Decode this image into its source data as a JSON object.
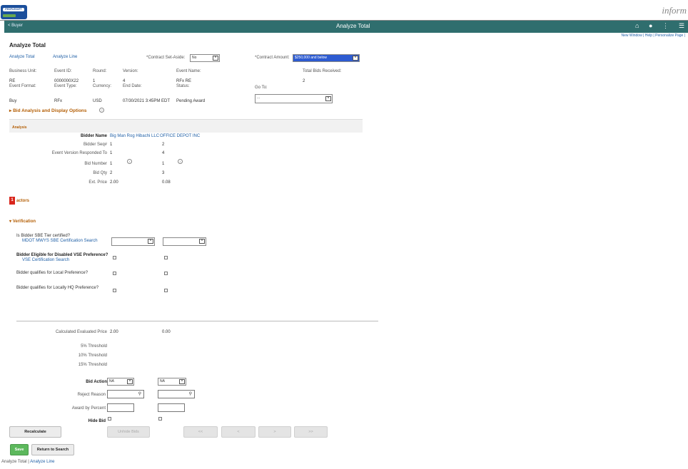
{
  "header": {
    "logo_text": "PEOPLESOFT",
    "brand": "inform",
    "back_label": "< Buyer",
    "title": "Analyze Total",
    "links": "New Window  |  Help  |  Personalize Page  |"
  },
  "page": {
    "title": "Analyze Total",
    "tab_links": [
      "Analyze Total",
      "Analyze Line"
    ],
    "contract_set_aside_label": "*Contract Set-Aside:",
    "contract_set_aside_value": "No",
    "contract_amount_label": "*Contract Amount:",
    "contract_amount_value": "$250,000 and below"
  },
  "event_info": {
    "labels_row1": [
      "Business Unit:",
      "Event ID:",
      "Round:",
      "Version:",
      "Event Name:",
      "Total Bids Received:"
    ],
    "values_row1": [
      "RE",
      "0000000X22",
      "1",
      "4",
      "RFx RE",
      "2"
    ],
    "labels_row2": [
      "Event Format:",
      "Event Type:",
      "Currency:",
      "End Date:",
      "Status:",
      "Go To:"
    ],
    "values_row2": [
      "Buy",
      "RFx",
      "USD",
      "07/30/2021 3:45PM EDT",
      "Pending Award"
    ],
    "goto_value": "..."
  },
  "bid_analysis_toggle": "Bid Analysis and Display Options",
  "analysis": {
    "section_label": "Analysis",
    "row_labels": [
      "Bidder Name",
      "Bidder Seq#",
      "Event Version Responded To",
      "Bid Number",
      "Bid Qty",
      "Ext. Price"
    ],
    "bidder1": [
      "Big Man Rog Hibachi LLC",
      "1",
      "1",
      "1",
      "2",
      "2.00"
    ],
    "bidder2": [
      "OFFICE DEPOT INC",
      "2",
      "4",
      "1",
      "3",
      "0.08"
    ]
  },
  "factors": {
    "badge": "1",
    "label": "actors"
  },
  "verification": {
    "header": "Verification",
    "q1": "Is Bidder SBE Tier certified?",
    "q1_link": "MDOT MWYS SBE Certification Search",
    "q2": "Bidder Eligible for Disabled VSE Preference?",
    "q2_link": "VSE Certification Search",
    "q3": "Bidder qualifies for Local Preference?",
    "q4": "Bidder qualifies for Locally HQ Preference?"
  },
  "evaluation": {
    "calc_label": "Calculated Evaluated Price",
    "calc_values": [
      "2.00",
      "0.00"
    ],
    "thresholds": [
      "5% Threshold",
      "10% Threshold",
      "15% Threshold"
    ],
    "bid_action_label": "Bid Action",
    "bid_action_values": [
      "NA",
      "NA"
    ],
    "reject_label": "Reject Reason",
    "award_pct_label": "Award by Percent",
    "hide_bid_label": "Hide Bid"
  },
  "buttons": {
    "recalculate": "Recalculate",
    "unhide": "Unhide Bids",
    "first": "<<",
    "prev": "<",
    "next": ">",
    "last": ">>",
    "save": "Save",
    "return": "Return to Search"
  },
  "footer": {
    "link1": "Analyze Total",
    "sep": "|",
    "link2": "Analyze Line"
  }
}
